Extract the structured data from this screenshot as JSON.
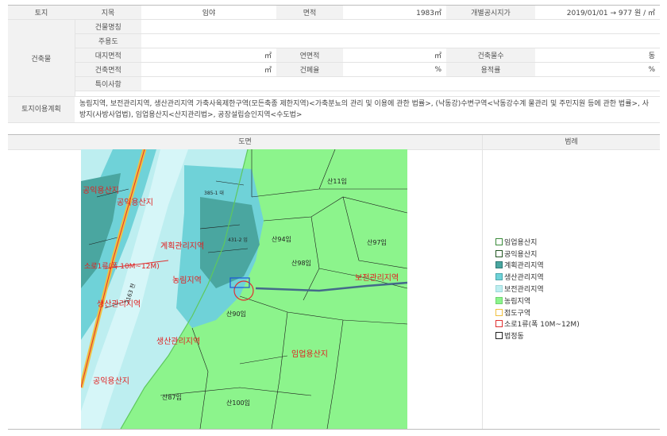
{
  "basic": {
    "land_label": "토지",
    "jimok_label": "지목",
    "jimok_value": "임야",
    "area_label": "면적",
    "area_value": "1983㎡",
    "price_label": "개별공시지가",
    "price_value": "2019/01/01 → 977 원 / ㎡"
  },
  "building": {
    "section_label": "건축물",
    "name_label": "건물명칭",
    "name_value": "",
    "use_label": "주용도",
    "use_value": "",
    "site_area_label": "대지면적",
    "site_area_unit": "㎡",
    "floor_area_label": "연면적",
    "floor_area_unit": "㎡",
    "floors_label": "건축물수",
    "floors_unit": "동",
    "build_area_label": "건축면적",
    "build_area_unit": "㎡",
    "coverage_label": "건폐율",
    "coverage_unit": "%",
    "far_label": "용적률",
    "far_unit": "%",
    "special_label": "특이사항",
    "special_value": ""
  },
  "land_use": {
    "label": "토지이용계획",
    "text": "농림지역, 보전관리지역, 생산관리지역 가축사육제한구역(모든축종 제한지역)<가축분뇨의 관리 및 이용에 관한 법률>, (낙동강)수변구역<낙동강수계 물관리 및 주민지원 등에 관한 법률>, 사방지(사방사업법), 임업용산지<산지관리법>, 공장설립승인지역<수도법>"
  },
  "lower": {
    "map_header": "도면",
    "legend_header": "범례"
  },
  "map_labels": {
    "san11": "산11임",
    "san94": "산94임",
    "san97": "산97임",
    "san98": "산98임",
    "san90": "산90임",
    "san87": "산87임",
    "san100": "산100임",
    "lot431": "431-2 임",
    "lot385": "385-1 대",
    "road": "2163 천",
    "zone_gong1": "공익용산지",
    "zone_gong2": "공익용산지",
    "zone_gong3": "공익용산지",
    "zone_saeng": "생산관리지역",
    "zone_gye": "계획관리지역",
    "zone_bojeon": "보전관리지역",
    "zone_imeop": "임업용산지",
    "zone_sangwan": "생산관리지역",
    "zone_nongrim": "농림지역",
    "road_label": "소로1류(폭 10M~12M)"
  },
  "legend": [
    {
      "label": "임업용산지",
      "fill": "#ffffff",
      "border": "#3a8a3a"
    },
    {
      "label": "공익용산지",
      "fill": "#ffffff",
      "border": "#225522"
    },
    {
      "label": "계획관리지역",
      "fill": "#4aa6a0",
      "border": "#2f7a75"
    },
    {
      "label": "생산관리지역",
      "fill": "#6fd2d8",
      "border": "#4aa6aa"
    },
    {
      "label": "보전관리지역",
      "fill": "#bdeef0",
      "border": "#9fd8da"
    },
    {
      "label": "농림지역",
      "fill": "#8cf48c",
      "border": "#6fd26f"
    },
    {
      "label": "접도구역",
      "fill": "#ffffff",
      "border": "#f0c040"
    },
    {
      "label": "소로1류(폭 10M~12M)",
      "fill": "#ffffff",
      "border": "#e03030"
    },
    {
      "label": "법정동",
      "fill": "#ffffff",
      "border": "#222222"
    }
  ]
}
